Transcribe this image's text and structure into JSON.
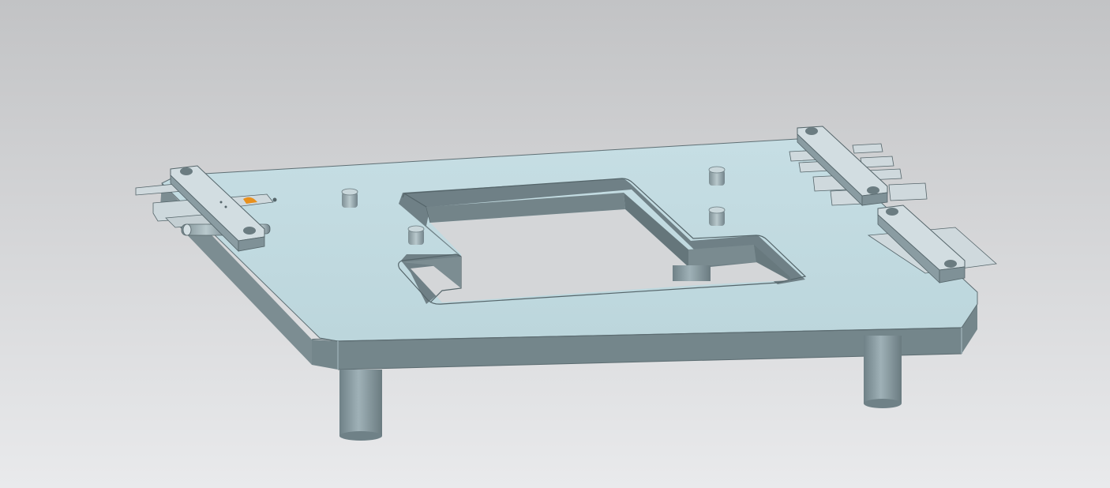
{
  "viewport": {
    "background_top": "#c2c3c5",
    "background_bottom": "#e9eaec"
  },
  "model": {
    "plate_top_color": "#c4dde3",
    "plate_side_color": "#7b8c91",
    "plate_edge_color": "#5f6f74",
    "hole_wall_color": "#6e7f84",
    "leg_color": "#8a9ca2",
    "rail_color": "#cfd9dd",
    "highlight_color": "#e8901c"
  }
}
